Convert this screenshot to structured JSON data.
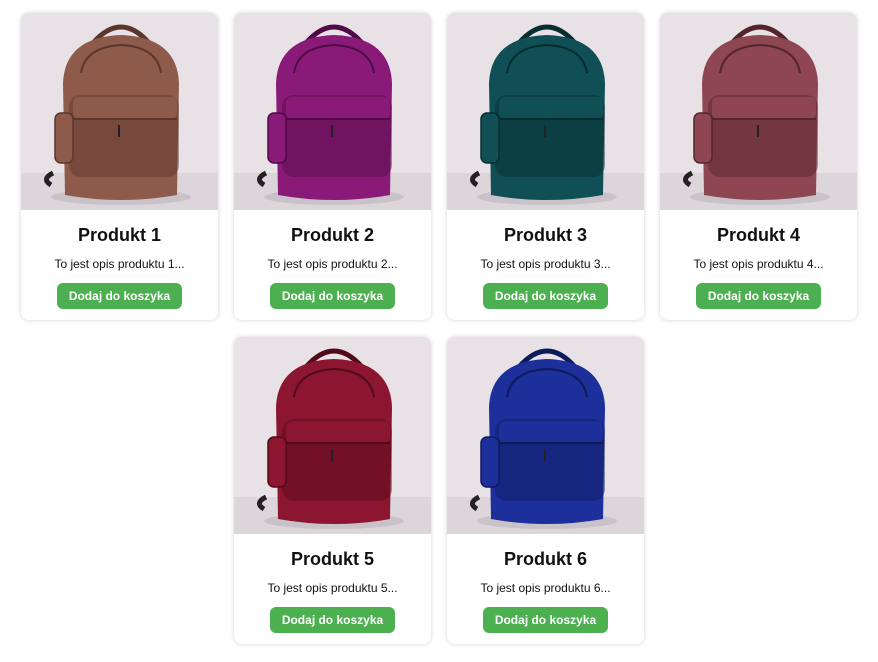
{
  "button_color": "#4caf50",
  "products": [
    {
      "name": "Produkt 1",
      "description": "To jest opis produktu 1...",
      "button_label": "Dodaj do koszyka",
      "color": "#8e5a4a",
      "dark": "#5a362d",
      "image": "backpack-brown"
    },
    {
      "name": "Produkt 2",
      "description": "To jest opis produktu 2...",
      "button_label": "Dodaj do koszyka",
      "color": "#8a1a78",
      "dark": "#4f0b45",
      "image": "backpack-purple"
    },
    {
      "name": "Produkt 3",
      "description": "To jest opis produktu 3...",
      "button_label": "Dodaj do koszyka",
      "color": "#0f4f55",
      "dark": "#082d31",
      "image": "backpack-teal"
    },
    {
      "name": "Produkt 4",
      "description": "To jest opis produktu 4...",
      "button_label": "Dodaj do koszyka",
      "color": "#8e4653",
      "dark": "#55252e",
      "image": "backpack-rose"
    },
    {
      "name": "Produkt 5",
      "description": "To jest opis produktu 5...",
      "button_label": "Dodaj do koszyka",
      "color": "#8c1530",
      "dark": "#520a1a",
      "image": "backpack-crimson"
    },
    {
      "name": "Produkt 6",
      "description": "To jest opis produktu 6...",
      "button_label": "Dodaj do koszyka",
      "color": "#1d2f9a",
      "dark": "#0f1a5a",
      "image": "backpack-blue"
    }
  ]
}
